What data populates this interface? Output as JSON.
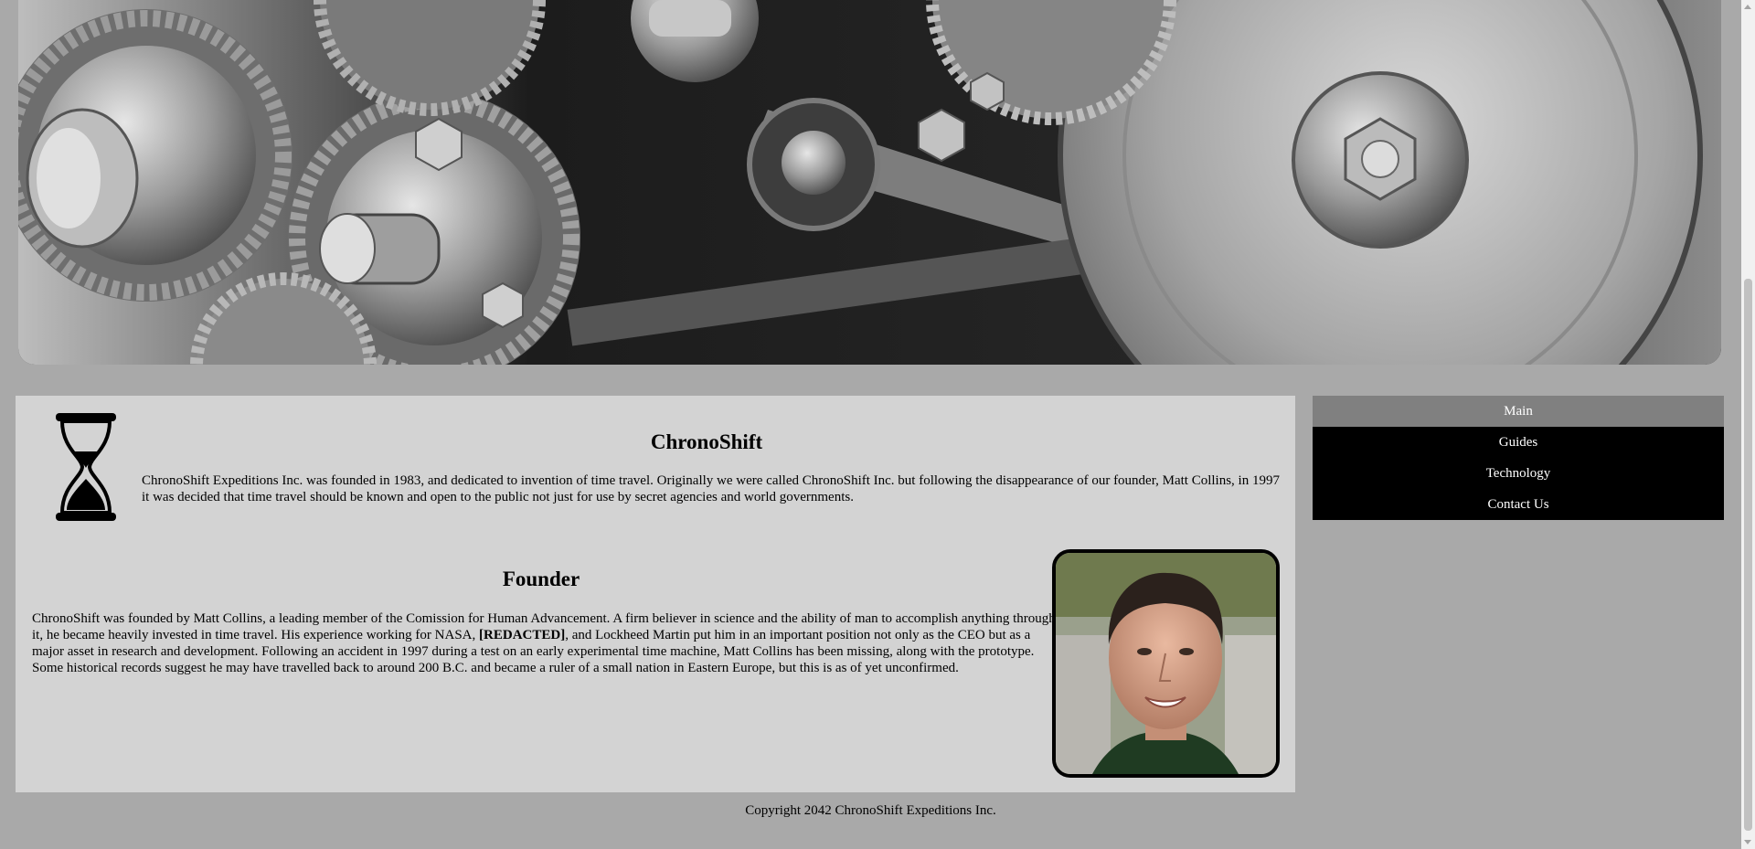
{
  "hero": {
    "image": "gears-photo"
  },
  "intro": {
    "icon": "hourglass-icon",
    "title": "ChronoShift",
    "text": "ChronoShift Expeditions Inc. was founded in 1983, and dedicated to invention of time travel. Originally we were called ChronoShift Inc. but following the disappearance of our founder, Matt Collins, in 1997 it was decided that time travel should be known and open to the public not just for use by secret agencies and world governments."
  },
  "founder": {
    "title": "Founder",
    "text_before": "ChronoShift was founded by Matt Collins, a leading member of the Comission for Human Advancement. A firm believer in science and the ability of man to accomplish anything through it, he became heavily invested in time travel. His experience working for NASA, ",
    "redacted": "[REDACTED]",
    "text_after": ", and Lockheed Martin put him in an important position not only as the CEO but as a major asset in research and development. Following an accident in 1997 during a test on an early experimental time machine, Matt Collins has been missing, along with the prototype. Some historical records suggest he may have travelled back to around 200 B.C. and became a ruler of a small nation in Eastern Europe, but this is as of yet unconfirmed.",
    "photo": "founder-portrait"
  },
  "nav": {
    "items": [
      {
        "label": "Main",
        "active": true
      },
      {
        "label": "Guides",
        "active": false
      },
      {
        "label": "Technology",
        "active": false
      },
      {
        "label": "Contact Us",
        "active": false
      }
    ]
  },
  "footer": {
    "copyright": "Copyright 2042 ChronoShift Expeditions Inc."
  },
  "colors": {
    "page_bg": "#a9a9a9",
    "content_bg": "#d3d3d3",
    "nav_bg": "#000000",
    "nav_active_bg": "#808080",
    "nav_text": "#ffffff"
  }
}
